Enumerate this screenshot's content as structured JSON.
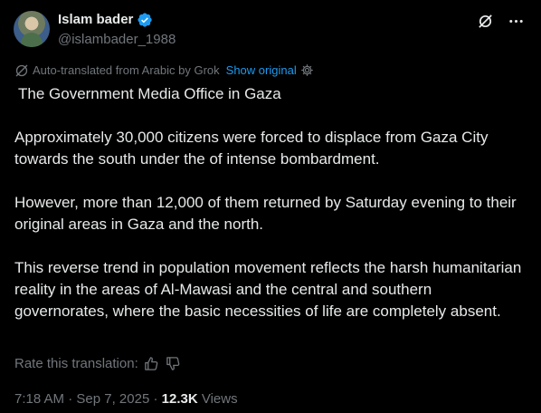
{
  "author": {
    "display_name": "Islam bader",
    "handle": "@islambader_1988"
  },
  "translation": {
    "notice": "Auto-translated from Arabic by Grok",
    "show_original": "Show original"
  },
  "post": {
    "title": "The Government Media Office in Gaza",
    "paragraphs": [
      "Approximately 30,000 citizens were forced to displace from Gaza City towards the south under the of intense bombardment.",
      "However, more than 12,000 of them returned by Saturday evening to their original areas in Gaza and the north.",
      "This reverse trend in population movement reflects the harsh humanitarian reality in the areas of Al-Mawasi and the central and southern governorates, where the basic necessities of life are completely absent."
    ]
  },
  "rate": {
    "label": "Rate this translation:"
  },
  "meta": {
    "time": "7:18 AM",
    "separator1": " · ",
    "date": "Sep 7, 2025",
    "separator2": " · ",
    "views_count": "12.3K",
    "views_label": " Views"
  },
  "colors": {
    "background": "#000000",
    "text": "#e7e9ea",
    "muted": "#71767b",
    "accent": "#1d9bf0"
  },
  "icons": {
    "verified": "verified-badge-icon",
    "grok": "grok-icon",
    "more": "more-icon",
    "translate": "translate-icon",
    "settings": "gear-icon",
    "thumbs_up": "thumbs-up-icon",
    "thumbs_down": "thumbs-down-icon"
  }
}
